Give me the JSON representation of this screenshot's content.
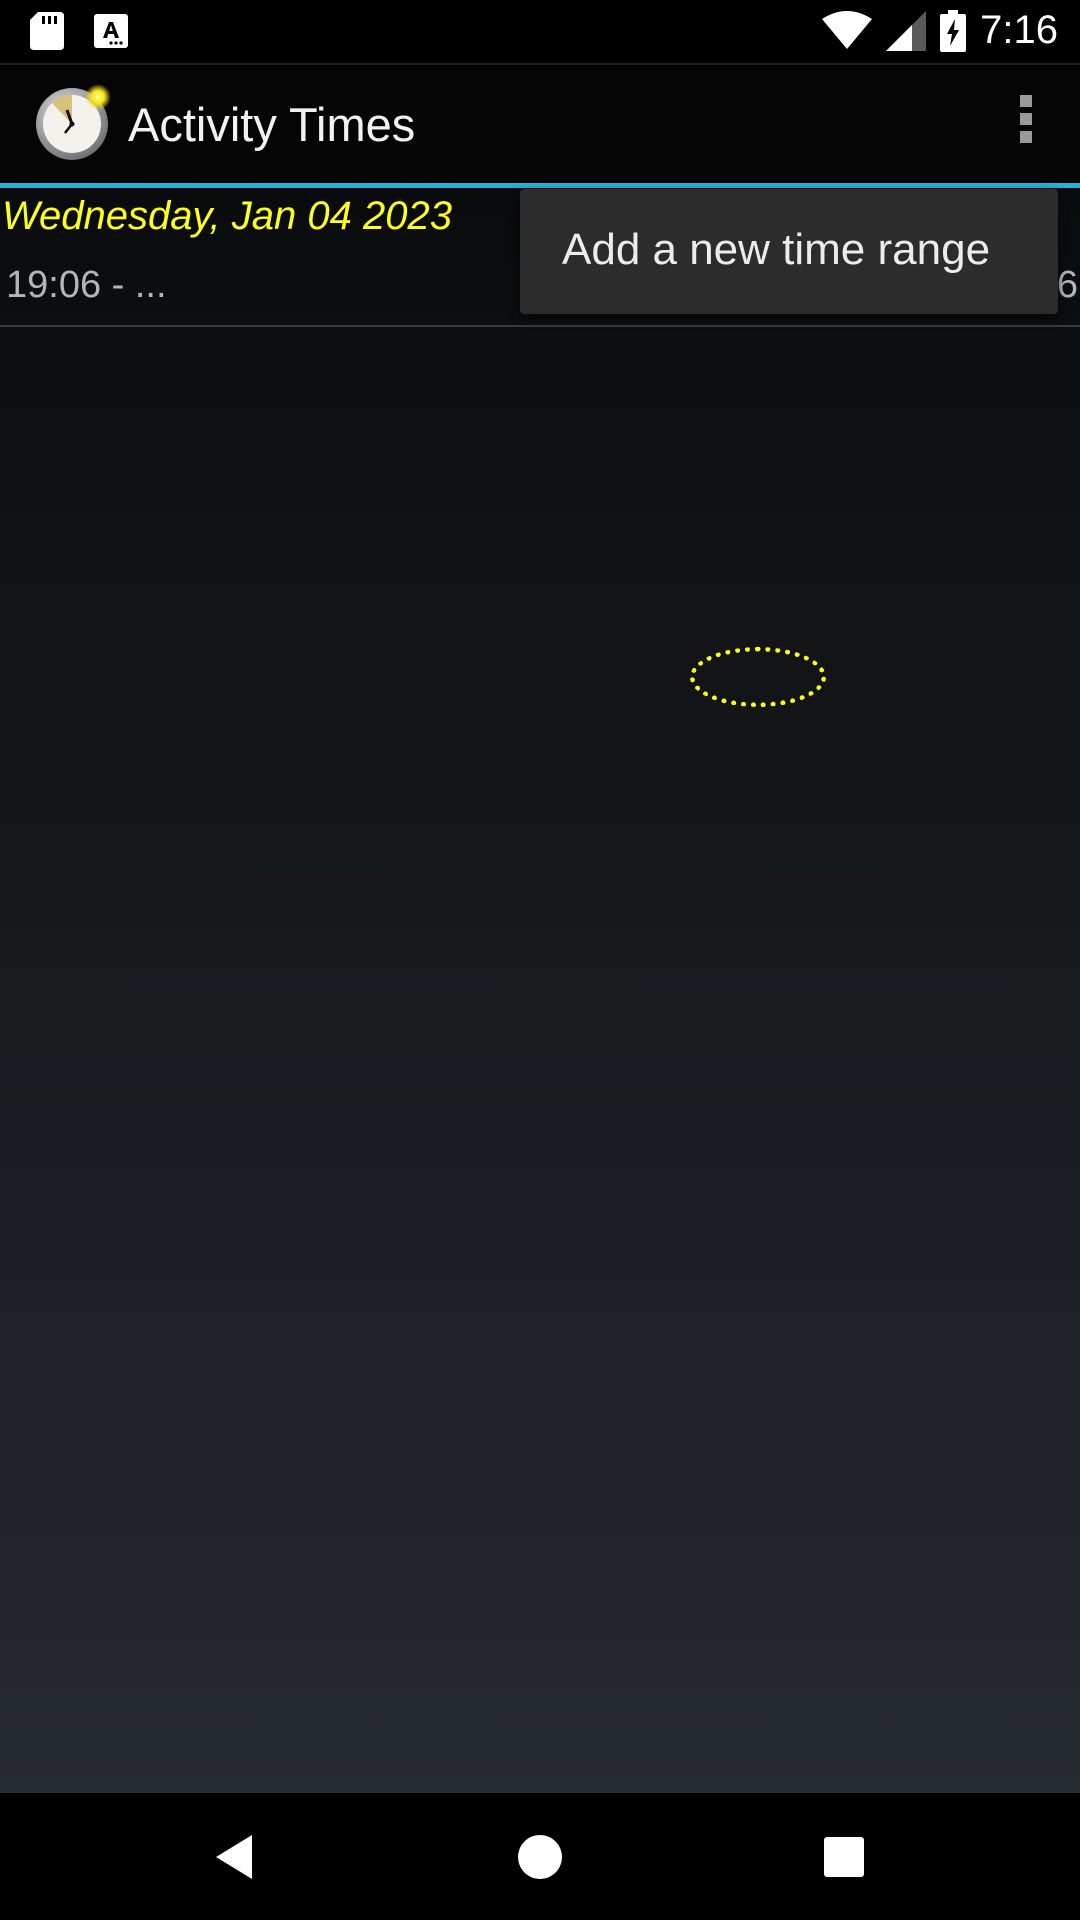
{
  "status_bar": {
    "time": "7:16",
    "left_icons": [
      "sd-card-icon",
      "text-notification-icon"
    ],
    "right_icons": [
      "wifi-icon",
      "cell-signal-icon",
      "battery-charging-icon"
    ]
  },
  "action_bar": {
    "title": "Activity Times",
    "icon": "stopwatch-app-icon",
    "overflow_icon": "more-vert-icon"
  },
  "list": {
    "items": [
      {
        "date": "Wednesday, Jan 04 2023",
        "time_range": "19:06 - ...",
        "duration_peek": "6"
      }
    ]
  },
  "popup_menu": {
    "items": [
      {
        "label": "Add a new time range"
      }
    ]
  },
  "nav_bar": {
    "buttons": [
      "back-icon",
      "home-icon",
      "recents-icon"
    ]
  },
  "colors": {
    "accent": "#29b0d9",
    "date_text": "#ffff1e",
    "tap_indicator": "#ffff1e"
  }
}
